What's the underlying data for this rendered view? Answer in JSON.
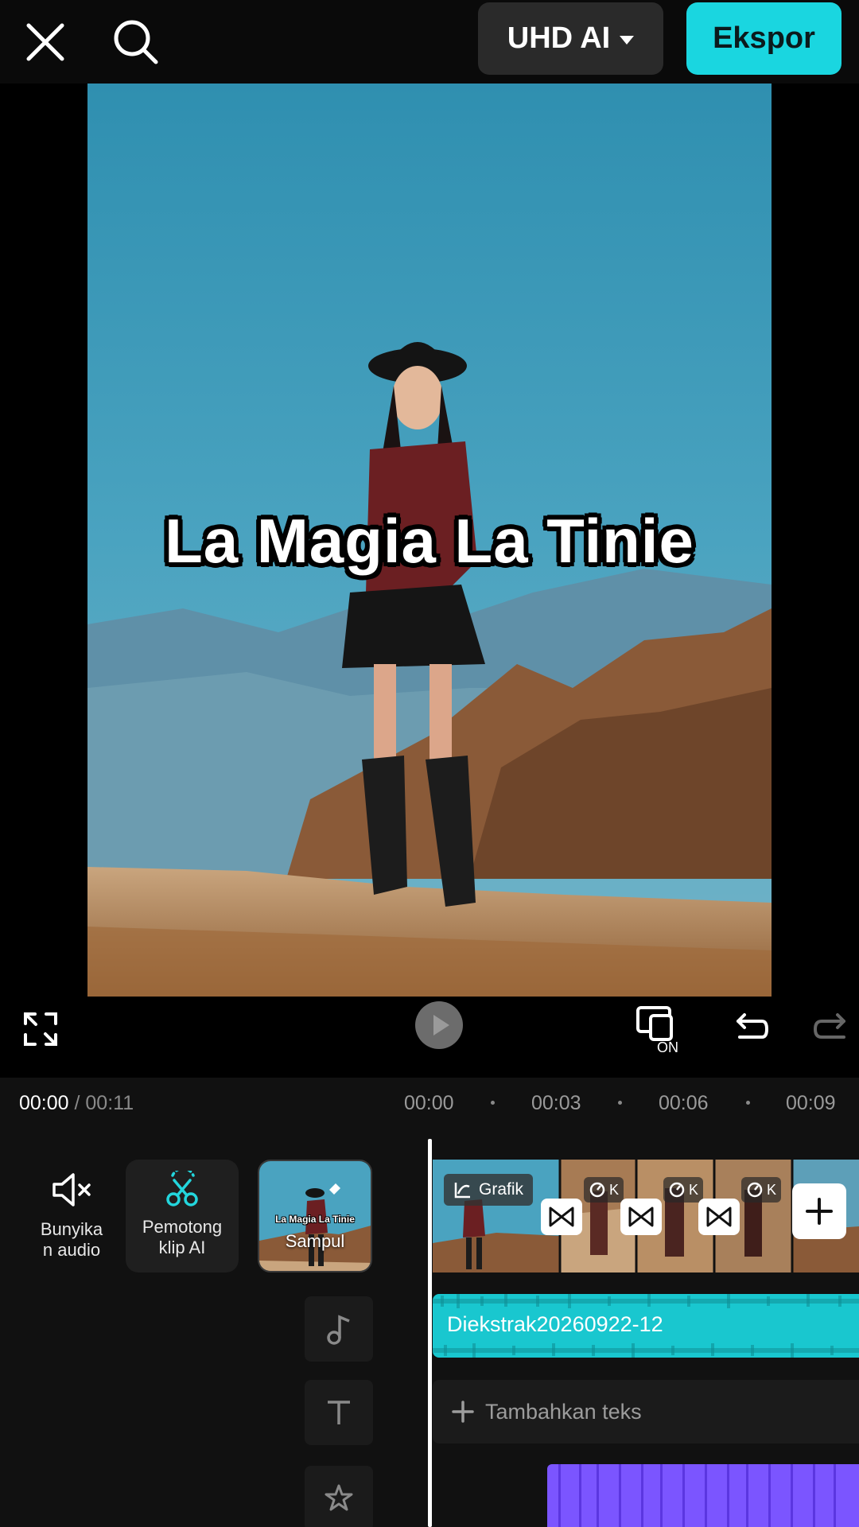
{
  "topbar": {
    "close_icon": "close-icon",
    "search_icon": "search-icon",
    "quality_label": "UHD AI",
    "export_label": "Ekspor",
    "accent_color": "#1ad6e0"
  },
  "preview": {
    "caption": "La Magia La Tinie"
  },
  "controls": {
    "fullscreen_icon": "fullscreen-icon",
    "play_icon": "play-icon",
    "on_label": "ON",
    "undo_icon": "undo-icon",
    "redo_icon": "redo-icon"
  },
  "timeline": {
    "current_time": "00:00",
    "separator": " / ",
    "duration": "00:11",
    "ruler": [
      "00:00",
      "00:03",
      "00:06",
      "00:09"
    ]
  },
  "tools": {
    "mute_label": "Bunyika\nn audio",
    "cutter_label": "Pemotong\nklip AI",
    "cover_label": "Sampul",
    "cover_title": "La Magia La Tinie"
  },
  "tracks": {
    "video_tag": "Grafik",
    "speed_tag": "K",
    "audio_name": "Diekstrak20260922-12",
    "add_text": "Tambahkan teks",
    "audio_color": "#19c7cf",
    "effect_color": "#7b55ff"
  }
}
